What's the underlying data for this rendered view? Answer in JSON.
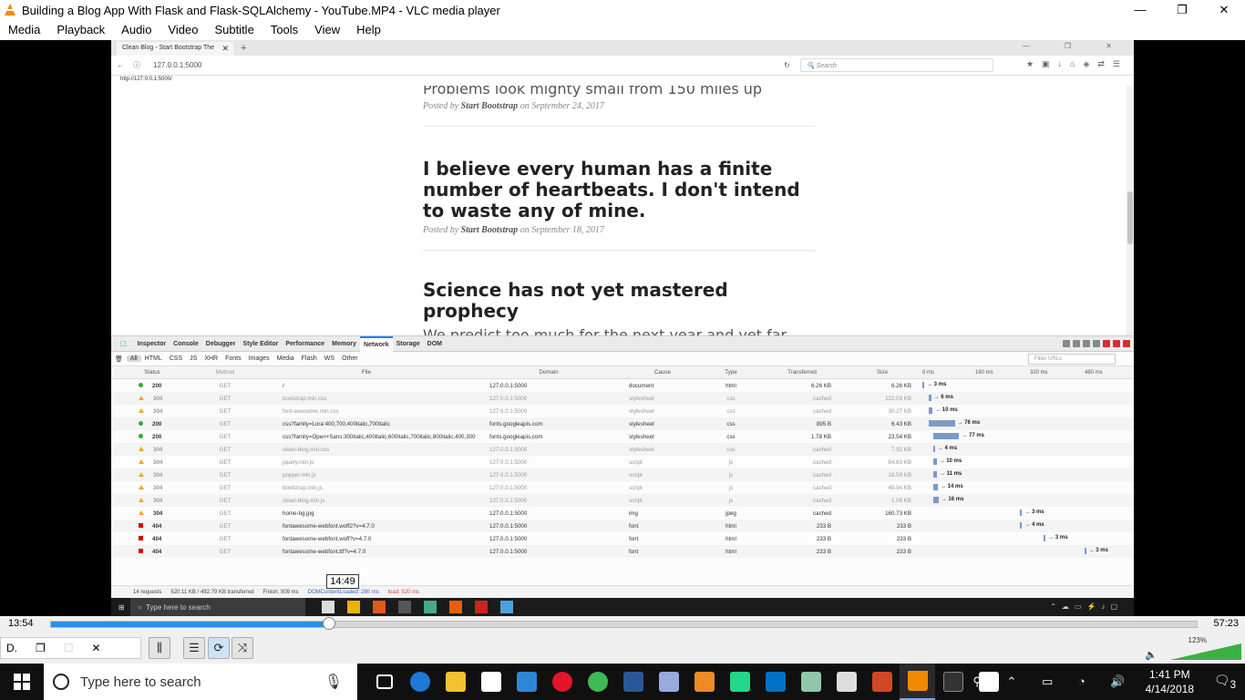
{
  "window": {
    "title": "Building a Blog App With Flask and Flask-SQLAlchemy - YouTube.MP4 - VLC media player",
    "controls": [
      "—",
      "❐",
      "✕"
    ]
  },
  "menu": [
    "Media",
    "Playback",
    "Audio",
    "Video",
    "Subtitle",
    "Tools",
    "View",
    "Help"
  ],
  "browser": {
    "tab_title": "Clean Blog - Start Bootstrap The",
    "url": "127.0.0.1:5000",
    "search_placeholder": "Search",
    "status_url": "http://127.0.0.1:5000/"
  },
  "posts": [
    {
      "title": "",
      "subtitle": "Problems look mighty small from 150 miles up",
      "meta_prefix": "Posted by",
      "author": "Start Bootstrap",
      "meta_on": "on",
      "date": "September 24, 2017"
    },
    {
      "title": "I believe every human has a finite number of heartbeats. I don't intend to waste any of mine.",
      "subtitle": "",
      "meta_prefix": "Posted by",
      "author": "Start Bootstrap",
      "meta_on": "on",
      "date": "September 18, 2017"
    },
    {
      "title": "Science has not yet mastered prophecy",
      "subtitle": "We predict too much for the next year and yet far too little for the next ten.",
      "meta_prefix": "",
      "author": "",
      "meta_on": "",
      "date": ""
    }
  ],
  "devtools": {
    "tabs": [
      "Inspector",
      "Console",
      "Debugger",
      "Style Editor",
      "Performance",
      "Memory",
      "Network",
      "Storage",
      "DOM"
    ],
    "active_tab": "Network",
    "filters": [
      "All",
      "HTML",
      "CSS",
      "JS",
      "XHR",
      "Fonts",
      "Images",
      "Media",
      "Flash",
      "WS",
      "Other"
    ],
    "filter_placeholder": "Filter URLs",
    "columns": [
      "Status",
      "Method",
      "File",
      "Domain",
      "Cause",
      "Type",
      "Transferred",
      "Size"
    ],
    "timeline_ticks": [
      "0 ms",
      "160 ms",
      "320 ms",
      "480 ms"
    ],
    "rows": [
      {
        "status": "200",
        "kind": "g",
        "method": "GET",
        "file": "/",
        "domain": "127.0.0.1:5000",
        "cause": "document",
        "type": "html",
        "transferred": "6.26 KB",
        "size": "6.26 KB",
        "ms": 3,
        "bar_start_ms": 0,
        "timing": "→ 3 ms",
        "cached": false
      },
      {
        "status": "304",
        "kind": "o",
        "method": "GET",
        "file": "bootstrap.min.css",
        "domain": "127.0.0.1:5000",
        "cause": "stylesheet",
        "type": "css",
        "transferred": "cached",
        "size": "122.03 KB",
        "ms": 6,
        "bar_start_ms": 20,
        "timing": "→ 6 ms",
        "cached": true
      },
      {
        "status": "304",
        "kind": "o",
        "method": "GET",
        "file": "font-awesome.min.css",
        "domain": "127.0.0.1:5000",
        "cause": "stylesheet",
        "type": "css",
        "transferred": "cached",
        "size": "30.27 KB",
        "ms": 10,
        "bar_start_ms": 20,
        "timing": "→ 10 ms",
        "cached": true
      },
      {
        "status": "200",
        "kind": "g",
        "method": "GET",
        "file": "css?family=Lora:400,700,400italic,700italic",
        "domain": "fonts.googleapis.com",
        "cause": "stylesheet",
        "type": "css",
        "transferred": "895 B",
        "size": "6.43 KB",
        "ms": 76,
        "bar_start_ms": 20,
        "timing": "→ 76 ms",
        "cached": false
      },
      {
        "status": "200",
        "kind": "g",
        "method": "GET",
        "file": "css?family=Open+Sans:300italic,400italic,600italic,700italic,800italic,400,300,",
        "domain": "fonts.googleapis.com",
        "cause": "stylesheet",
        "type": "css",
        "transferred": "1.78 KB",
        "size": "23.54 KB",
        "ms": 77,
        "bar_start_ms": 32,
        "timing": "→ 77 ms",
        "cached": false
      },
      {
        "status": "304",
        "kind": "o",
        "method": "GET",
        "file": "clean-blog.min.css",
        "domain": "127.0.0.1:5000",
        "cause": "stylesheet",
        "type": "css",
        "transferred": "cached",
        "size": "7.92 KB",
        "ms": 4,
        "bar_start_ms": 32,
        "timing": "→ 4 ms",
        "cached": true
      },
      {
        "status": "304",
        "kind": "o",
        "method": "GET",
        "file": "jquery.min.js",
        "domain": "127.0.0.1:5000",
        "cause": "script",
        "type": "js",
        "transferred": "cached",
        "size": "84.63 KB",
        "ms": 10,
        "bar_start_ms": 32,
        "timing": "→ 10 ms",
        "cached": true
      },
      {
        "status": "304",
        "kind": "o",
        "method": "GET",
        "file": "popper.min.js",
        "domain": "127.0.0.1:5000",
        "cause": "script",
        "type": "js",
        "transferred": "cached",
        "size": "18.59 KB",
        "ms": 11,
        "bar_start_ms": 32,
        "timing": "→ 11 ms",
        "cached": true
      },
      {
        "status": "304",
        "kind": "o",
        "method": "GET",
        "file": "bootstrap.min.js",
        "domain": "127.0.0.1:5000",
        "cause": "script",
        "type": "js",
        "transferred": "cached",
        "size": "49.94 KB",
        "ms": 14,
        "bar_start_ms": 32,
        "timing": "→ 14 ms",
        "cached": true
      },
      {
        "status": "304",
        "kind": "o",
        "method": "GET",
        "file": "clean-blog.min.js",
        "domain": "127.0.0.1:5000",
        "cause": "script",
        "type": "js",
        "transferred": "cached",
        "size": "1.08 KB",
        "ms": 16,
        "bar_start_ms": 32,
        "timing": "→ 16 ms",
        "cached": true
      },
      {
        "status": "304",
        "kind": "o",
        "method": "GET",
        "file": "home-bg.jpg",
        "domain": "127.0.0.1:5000",
        "cause": "img",
        "type": "jpeg",
        "transferred": "cached",
        "size": "160.73 KB",
        "ms": 3,
        "bar_start_ms": 290,
        "timing": "→ 3 ms",
        "cached": false
      },
      {
        "status": "404",
        "kind": "r",
        "method": "GET",
        "file": "fontawesome-webfont.woff2?v=4.7.0",
        "domain": "127.0.0.1:5000",
        "cause": "font",
        "type": "html",
        "transferred": "233 B",
        "size": "233 B",
        "ms": 4,
        "bar_start_ms": 290,
        "timing": "→ 4 ms",
        "cached": false
      },
      {
        "status": "404",
        "kind": "r",
        "method": "GET",
        "file": "fontawesome-webfont.woff?v=4.7.0",
        "domain": "127.0.0.1:5000",
        "cause": "font",
        "type": "html",
        "transferred": "233 B",
        "size": "233 B",
        "ms": 3,
        "bar_start_ms": 360,
        "timing": "→ 3 ms",
        "cached": false
      },
      {
        "status": "404",
        "kind": "r",
        "method": "GET",
        "file": "fontawesome-webfont.ttf?v=4.7.0",
        "domain": "127.0.0.1:5000",
        "cause": "font",
        "type": "html",
        "transferred": "233 B",
        "size": "233 B",
        "ms": 3,
        "bar_start_ms": 480,
        "timing": "→ 3 ms",
        "cached": false
      }
    ],
    "footer": {
      "requests": "14 requests",
      "transferred": "520.11 KB / 492.79 KB transferred",
      "finish": "Finish: 509 ms",
      "dom": "DOMContentLoaded: 280 ms",
      "load": "load: 520 ms"
    }
  },
  "inner_taskbar": {
    "search": "Type here to search"
  },
  "seek": {
    "current": "13:54",
    "total": "57:23",
    "tooltip": "14:49",
    "progress_fraction": 0.2423
  },
  "volume": {
    "percent": "123%"
  },
  "mini_window": {
    "label": "D."
  },
  "taskbar": {
    "search": "Type here to search",
    "time": "1:41 PM",
    "date": "4/14/2018",
    "notifications": "3"
  }
}
